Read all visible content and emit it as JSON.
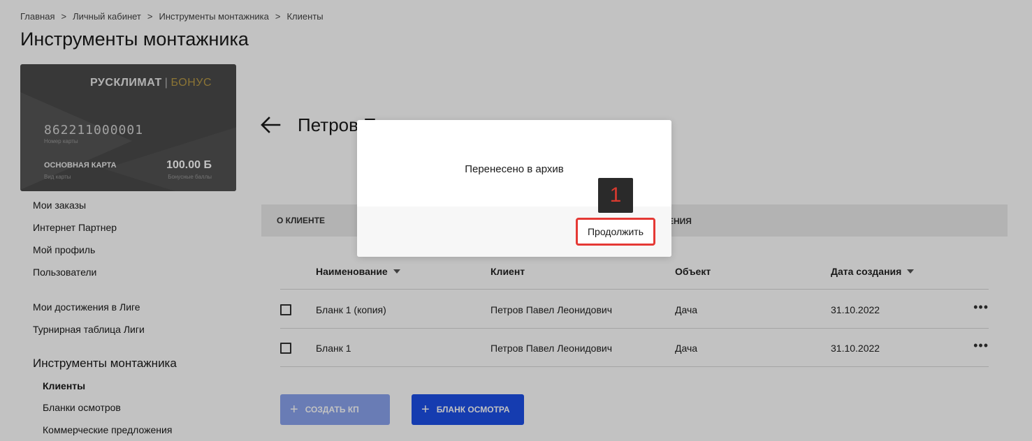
{
  "breadcrumb": [
    "Главная",
    "Личный кабинет",
    "Инструменты монтажника",
    "Клиенты"
  ],
  "breadcrumb_separator": ">",
  "page_title": "Инструменты монтажника",
  "card": {
    "brand": "РУСКЛИМАТ",
    "brand_separator": "|",
    "brand_suffix": "БОНУС",
    "number": "862211000001",
    "number_label": "Номер карты",
    "type": "ОСНОВНАЯ КАРТА",
    "type_label": "Вид карты",
    "points": "100.00 Б",
    "points_label": "Бонусные баллы"
  },
  "sidebar": {
    "items": [
      "Мои заказы",
      "Интернет Партнер",
      "Мой профиль",
      "Пользователи"
    ],
    "league_items": [
      "Мои достижения в Лиге",
      "Турнирная таблица Лиги"
    ],
    "section_title": "Инструменты монтажника",
    "sub_items": [
      "Клиенты",
      "Бланки осмотров",
      "Коммерческие предложения"
    ],
    "active_sub_item": "Клиенты"
  },
  "client": {
    "title_visible": "Петров П"
  },
  "tabs": {
    "about": "О КЛИЕНТЕ",
    "third_partial": "ЕНИЯ"
  },
  "table": {
    "headers": {
      "name": "Наименование",
      "client": "Клиент",
      "object": "Объект",
      "created": "Дата создания"
    },
    "rows": [
      {
        "name": "Бланк 1 (копия)",
        "client": "Петров Павел Леонидович",
        "object": "Дача",
        "created": "31.10.2022"
      },
      {
        "name": "Бланк 1",
        "client": "Петров Павел Леонидович",
        "object": "Дача",
        "created": "31.10.2022"
      }
    ],
    "more_glyph": "•••"
  },
  "buttons": {
    "create_kp": "СОЗДАТЬ КП",
    "blank_inspection": "БЛАНК ОСМОТРА",
    "plus_glyph": "+"
  },
  "dialog": {
    "message": "Перенесено в архив",
    "continue_label": "Продолжить"
  },
  "marker": {
    "label": "1"
  },
  "colors": {
    "primary_blue": "#1c4fe8",
    "disabled_blue": "#8aa3ee",
    "highlight_red": "#e53935",
    "bonus_gold": "#b89a46"
  }
}
